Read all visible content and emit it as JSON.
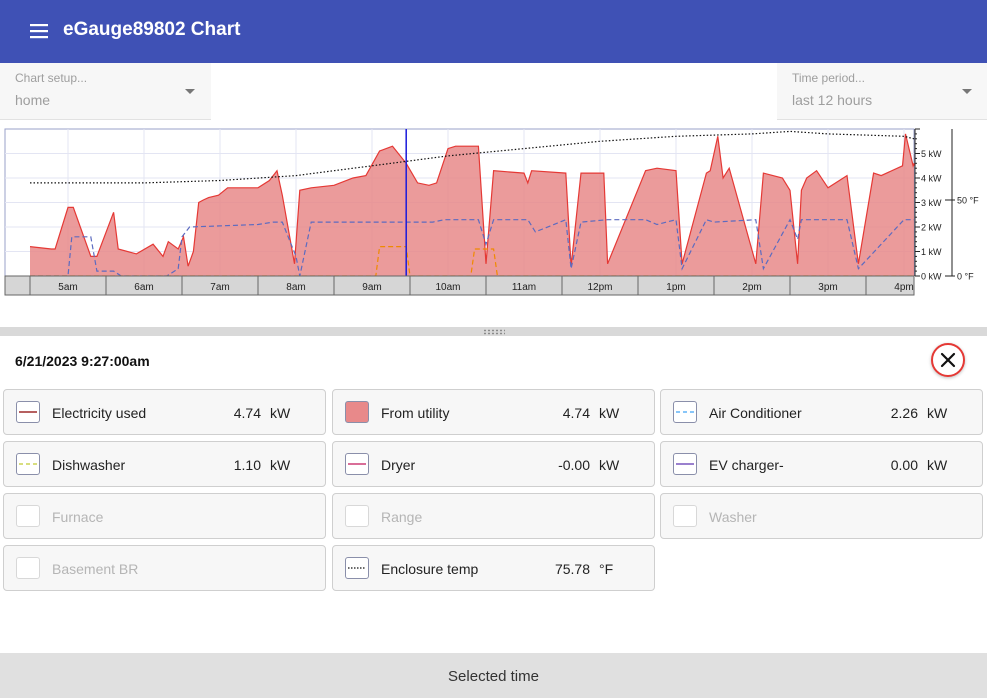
{
  "app": {
    "title": "eGauge89802 Chart"
  },
  "setup": {
    "label": "Chart setup...",
    "value": "home"
  },
  "period": {
    "label": "Time period...",
    "value": "last 12 hours"
  },
  "chart_data": {
    "type": "area",
    "x_tick_labels": [
      "5am",
      "6am",
      "7am",
      "8am",
      "9am",
      "10am",
      "11am",
      "12pm",
      "1pm",
      "2pm",
      "3pm",
      "4pm"
    ],
    "y_left_ticks": [
      "0 kW",
      "1 kW",
      "2 kW",
      "3 kW",
      "4 kW",
      "5 kW"
    ],
    "y_right_ticks": [
      "0 °F",
      "50 °F"
    ],
    "ylim_kw": [
      0,
      6
    ],
    "cursor_time": "9:27am",
    "x_start_hour": 4.5,
    "x_end_hour": 16.83,
    "series": [
      {
        "name": "From utility",
        "style": "filled",
        "color": "#e8898a",
        "x_hours": [
          4.5,
          4.78,
          4.83,
          5.0,
          5.07,
          5.3,
          5.38,
          5.6,
          5.66,
          5.9,
          6.12,
          6.25,
          6.32,
          6.45,
          6.52,
          6.58,
          6.65,
          6.72,
          6.78,
          6.85,
          6.98,
          7.1,
          7.5,
          7.65,
          7.75,
          7.82,
          7.98,
          8.05,
          8.2,
          8.5,
          8.75,
          8.92,
          9.1,
          9.27,
          9.45,
          9.6,
          9.75,
          9.85,
          10.0,
          10.1,
          10.4,
          10.5,
          10.6,
          11.0,
          11.05,
          11.1,
          11.55,
          11.62,
          11.75,
          12.05,
          12.1,
          12.6,
          12.75,
          13.0,
          13.08,
          13.4,
          13.45,
          13.55,
          13.62,
          13.7,
          14.05,
          14.15,
          14.4,
          14.5,
          14.6,
          14.65,
          14.72,
          14.85,
          15.0,
          15.25,
          15.4,
          15.6,
          15.7,
          15.98,
          16.02,
          16.12,
          16.5,
          16.83
        ],
        "y_kw": [
          1.2,
          1.1,
          1.1,
          2.8,
          2.8,
          0.8,
          0.8,
          2.6,
          1.1,
          0.9,
          1.3,
          0.8,
          1.4,
          1.1,
          1.6,
          0.4,
          1.0,
          3.0,
          3.1,
          3.2,
          3.3,
          3.6,
          3.6,
          3.9,
          4.3,
          3.3,
          0.5,
          3.5,
          3.6,
          3.7,
          4.0,
          4.1,
          5.1,
          5.3,
          4.6,
          3.8,
          3.7,
          3.8,
          5.2,
          5.3,
          5.3,
          0.5,
          4.3,
          4.2,
          3.8,
          4.3,
          4.2,
          0.4,
          4.2,
          4.2,
          0.5,
          4.3,
          4.4,
          4.3,
          0.5,
          4.2,
          4.3,
          5.7,
          4.0,
          4.4,
          0.5,
          4.2,
          4.0,
          3.5,
          0.5,
          3.5,
          4.0,
          4.3,
          3.6,
          4.1,
          0.5,
          4.2,
          4.1,
          4.5,
          5.8,
          4.5,
          4.6,
          4.5
        ]
      },
      {
        "name": "Air Conditioner",
        "style": "dashed",
        "color": "#5c6bc0",
        "x_hours": [
          4.5,
          5.0,
          5.05,
          5.3,
          5.38,
          5.6,
          5.7,
          6.3,
          6.45,
          6.5,
          6.6,
          7.5,
          7.7,
          7.82,
          8.0,
          8.05,
          8.2,
          9.8,
          9.95,
          10.4,
          10.5,
          10.6,
          11.05,
          11.15,
          11.55,
          11.62,
          11.75,
          12.1,
          12.6,
          12.75,
          13.0,
          13.08,
          13.4,
          13.5,
          14.05,
          14.15,
          14.5,
          14.6,
          14.65,
          14.75,
          15.25,
          15.4,
          16.0,
          16.83
        ],
        "y_kw": [
          0,
          0,
          1.6,
          1.6,
          0.2,
          0.2,
          0,
          0,
          0.3,
          1.6,
          2.0,
          2.1,
          2.2,
          2.2,
          0.8,
          0,
          2.2,
          2.2,
          2.3,
          2.3,
          1.3,
          2.3,
          2.3,
          1.8,
          2.3,
          0.3,
          2.2,
          2.3,
          2.3,
          2.1,
          2.3,
          0.3,
          2.3,
          2.2,
          2.3,
          0.3,
          2.3,
          1.5,
          2.3,
          2.3,
          2.3,
          0.3,
          2.3,
          2.3
        ]
      },
      {
        "name": "Dishwasher",
        "style": "dashed",
        "color": "#ef8a00",
        "x_hours": [
          4.5,
          9.05,
          9.1,
          9.45,
          9.5,
          9.8,
          10.3,
          10.35,
          10.6,
          10.65,
          16.83
        ],
        "y_kw": [
          0,
          0,
          1.2,
          1.2,
          0,
          0,
          0,
          1.1,
          1.1,
          0,
          0
        ]
      },
      {
        "name": "Enclosure temp",
        "style": "dotted",
        "color": "#111111",
        "x_hours": [
          4.5,
          6.0,
          7.0,
          8.0,
          9.0,
          10.0,
          11.0,
          12.0,
          13.0,
          14.0,
          14.5,
          15.0,
          16.0,
          16.83
        ],
        "y_kw": [
          3.8,
          3.8,
          3.9,
          4.1,
          4.5,
          4.9,
          5.2,
          5.5,
          5.7,
          5.8,
          5.9,
          5.8,
          5.7,
          5.6
        ]
      }
    ]
  },
  "selected_time": "6/21/2023 9:27:00am",
  "channels": [
    {
      "name": "Electricity used",
      "value": "4.74",
      "unit": "kW",
      "active": true,
      "style": "line",
      "color": "#8b0000"
    },
    {
      "name": "From utility",
      "value": "4.74",
      "unit": "kW",
      "active": true,
      "style": "fill",
      "color": "#e8898a"
    },
    {
      "name": "Air Conditioner",
      "value": "2.26",
      "unit": "kW",
      "active": true,
      "style": "dashed",
      "color": "#42a5f5"
    },
    {
      "name": "Dishwasher",
      "value": "1.10",
      "unit": "kW",
      "active": true,
      "style": "dashed",
      "color": "#c0ca33"
    },
    {
      "name": "Dryer",
      "value": "-0.00",
      "unit": "kW",
      "active": true,
      "style": "line",
      "color": "#c2185b"
    },
    {
      "name": "EV charger-",
      "value": "0.00",
      "unit": "kW",
      "active": true,
      "style": "line",
      "color": "#5e35b1"
    },
    {
      "name": "Furnace",
      "value": "",
      "unit": "",
      "active": false,
      "style": "none",
      "color": "#cccccc"
    },
    {
      "name": "Range",
      "value": "",
      "unit": "",
      "active": false,
      "style": "none",
      "color": "#cccccc"
    },
    {
      "name": "Washer",
      "value": "",
      "unit": "",
      "active": false,
      "style": "none",
      "color": "#cccccc"
    },
    {
      "name": "Basement BR",
      "value": "",
      "unit": "",
      "active": false,
      "style": "none",
      "color": "#cccccc"
    },
    {
      "name": "Enclosure temp",
      "value": "75.78",
      "unit": "°F",
      "active": true,
      "style": "dotted",
      "color": "#111111"
    }
  ],
  "bottom": {
    "label": "Selected time"
  },
  "icons": {
    "menu": "menu-icon",
    "dropdown": "chevron-down-icon",
    "close": "close-icon",
    "grip": "drag-handle-icon"
  }
}
